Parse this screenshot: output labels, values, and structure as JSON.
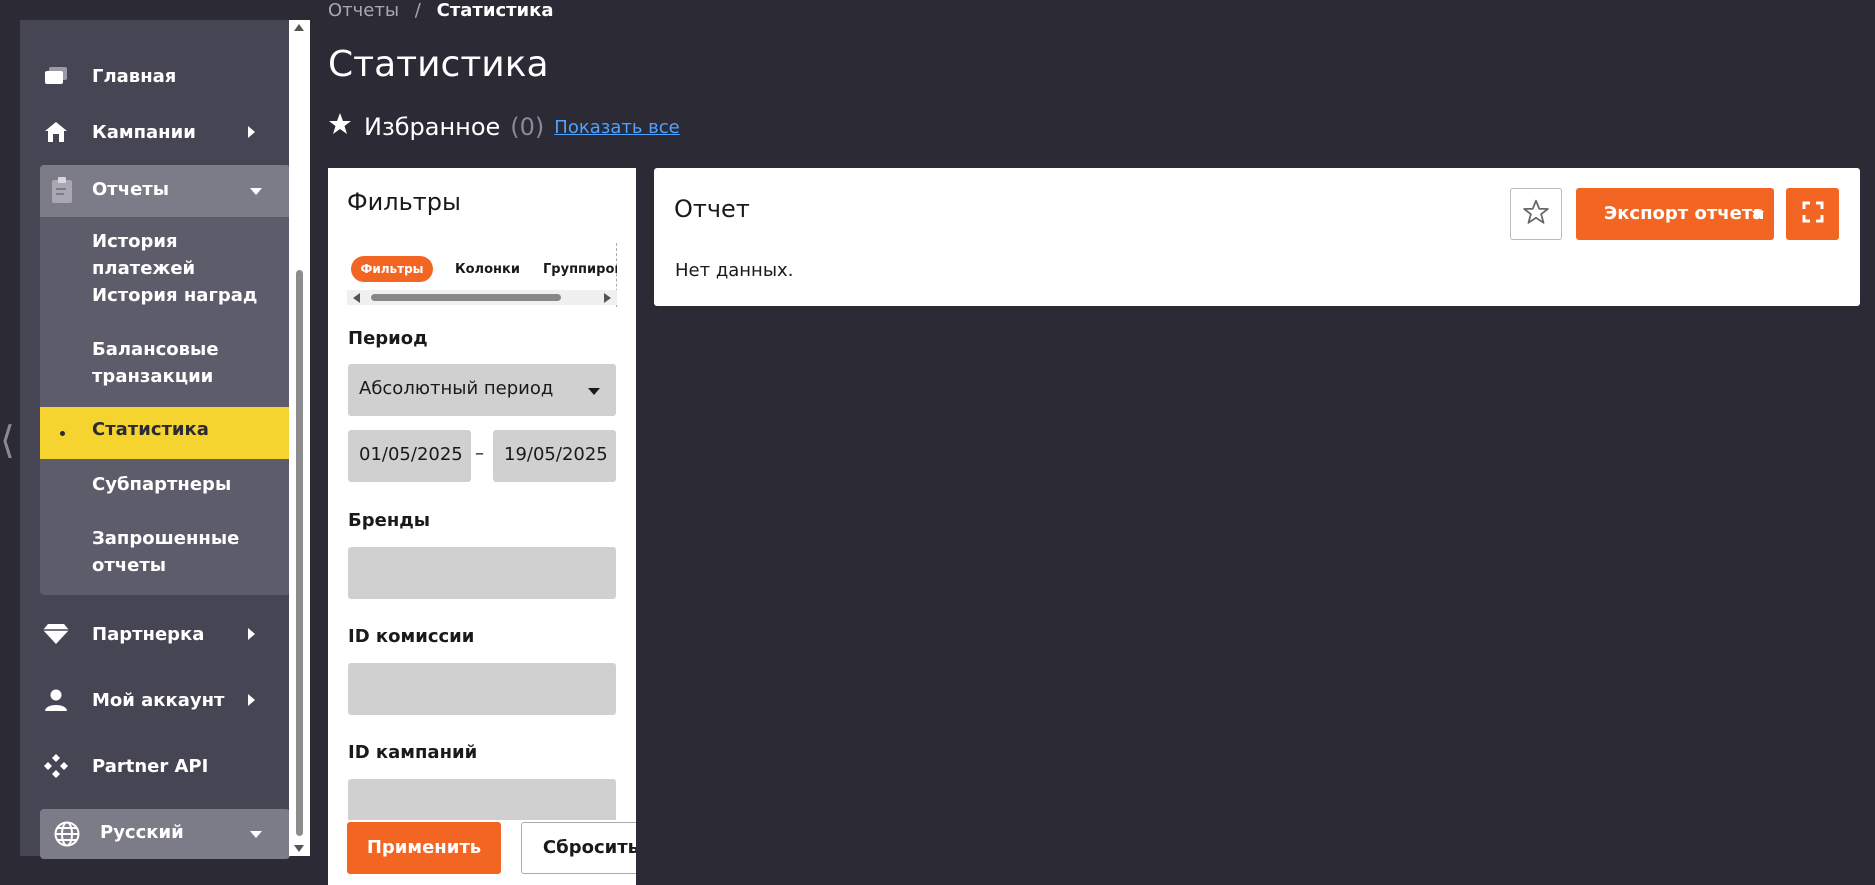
{
  "sidebar": {
    "items": {
      "home": {
        "label": "Главная",
        "icon": "cards-icon"
      },
      "campaigns": {
        "label": "Кампании",
        "icon": "house-icon"
      },
      "reports": {
        "label": "Отчеты",
        "icon": "clipboard-icon"
      },
      "partner": {
        "label": "Партнерка",
        "icon": "diamond-icon"
      },
      "account": {
        "label": "Мой аккаунт",
        "icon": "user-icon"
      },
      "api": {
        "label": "Partner API",
        "icon": "api-icon"
      }
    },
    "reports_sub": {
      "payments": "История платежей",
      "rewards": "История наград",
      "balance": "Балансовые транзакции",
      "stats": "Статистика",
      "subpartners": "Субпартнеры",
      "requested": "Запрошенные отчеты"
    },
    "language": {
      "label": "Русский",
      "icon": "globe-icon"
    }
  },
  "breadcrumb": {
    "parent": "Отчеты",
    "separator": "/",
    "current": "Статистика"
  },
  "page": {
    "title": "Статистика"
  },
  "favorites": {
    "label": "Избранное",
    "count": "(0)",
    "show_all": "Показать все"
  },
  "filters": {
    "title": "Фильтры",
    "tabs": {
      "filters": "Фильтры",
      "columns": "Колонки",
      "grouping": "Группировать"
    },
    "period_label": "Период",
    "period_value": "Абсолютный период",
    "date_from": "01/05/2025",
    "date_sep": "–",
    "date_to": "19/05/2025",
    "brands_label": "Бренды",
    "commission_label": "ID комиссии",
    "campaigns_label": "ID кампаний",
    "apply": "Применить",
    "reset": "Сбросить"
  },
  "report": {
    "title": "Отчет",
    "empty": "Нет данных.",
    "export": "Экспорт отчета"
  },
  "colors": {
    "accent": "#f26522",
    "active": "#f5d430",
    "background": "#2b2a35",
    "sidebar": "#464554"
  }
}
